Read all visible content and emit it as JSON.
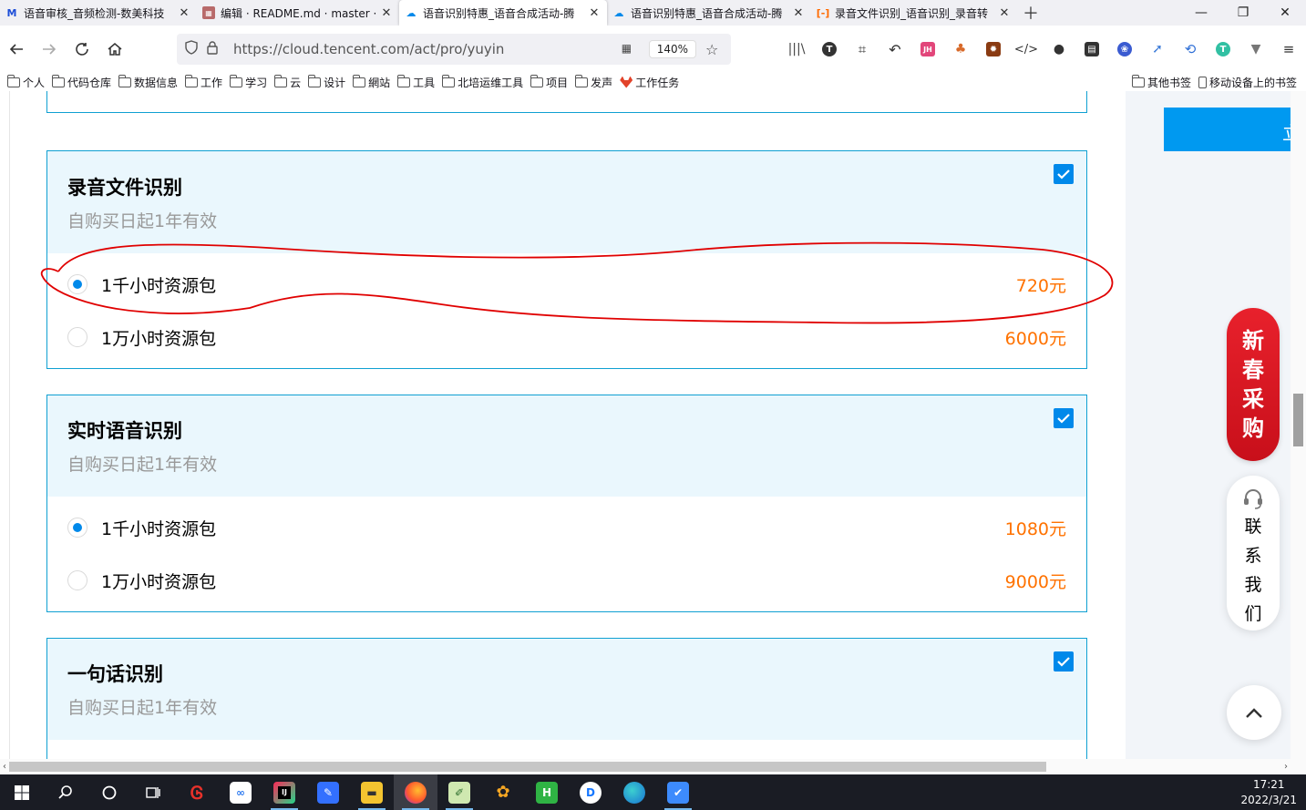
{
  "browser": {
    "tabs": [
      {
        "title": "语音审核_音频检测-数美科技",
        "favicon": "shumei-icon",
        "active": false
      },
      {
        "title": "编辑 · README.md · master · (",
        "favicon": "gitlab-icon",
        "active": false
      },
      {
        "title": "语音识别特惠_语音合成活动-腾",
        "favicon": "tencent-cloud-icon",
        "active": true
      },
      {
        "title": "语音识别特惠_语音合成活动-腾",
        "favicon": "tencent-cloud-icon",
        "active": false
      },
      {
        "title": "录音文件识别_语音识别_录音转",
        "favicon": "aliyun-icon",
        "active": false
      }
    ],
    "url": "https://cloud.tencent.com/act/pro/yuyin",
    "zoom": "140%",
    "bookmarks": [
      "个人",
      "代码仓库",
      "数据信息",
      "工作",
      "学习",
      "云",
      "设计",
      "網站",
      "工具",
      "北培运维工具",
      "项目",
      "发声",
      "工作任务"
    ],
    "bookmarks_right": [
      "其他书签",
      "移动设备上的书签"
    ]
  },
  "cards": [
    {
      "name": "录音文件识别",
      "validity": "自购买日起1年有效",
      "checked": true,
      "options": [
        {
          "label": "1千小时资源包",
          "price": "720元",
          "selected": true
        },
        {
          "label": "1万小时资源包",
          "price": "6000元",
          "selected": false
        }
      ]
    },
    {
      "name": "实时语音识别",
      "validity": "自购买日起1年有效",
      "checked": true,
      "options": [
        {
          "label": "1千小时资源包",
          "price": "1080元",
          "selected": true
        },
        {
          "label": "1万小时资源包",
          "price": "9000元",
          "selected": false
        }
      ]
    },
    {
      "name": "一句话识别",
      "validity": "自购买日起1年有效",
      "checked": true,
      "options": []
    }
  ],
  "side": {
    "buy_button_partial": "立",
    "promo": [
      "新",
      "春",
      "采",
      "购"
    ],
    "contact": [
      "联",
      "系",
      "我",
      "们"
    ]
  },
  "taskbar": {
    "time": "17:21",
    "date": "2022/3/21"
  },
  "colors": {
    "accent": "#0089ea",
    "price": "#ff7200",
    "card_border": "#0fa0d2",
    "card_head_bg": "#eaf7fd",
    "annotation": "#e00000"
  }
}
